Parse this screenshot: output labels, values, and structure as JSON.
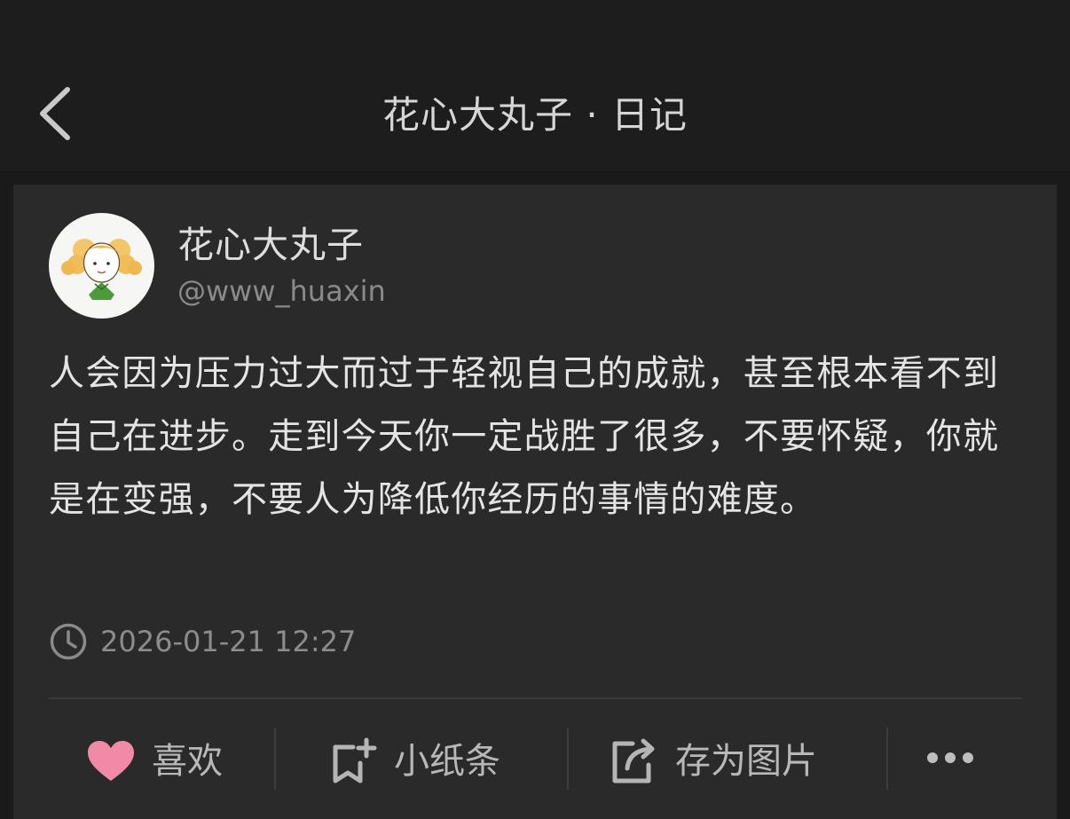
{
  "header": {
    "title": "花心大丸子 · 日记",
    "back_icon": "chevron-left-icon"
  },
  "post": {
    "author": {
      "name": "花心大丸子",
      "handle": "@www_huaxin",
      "avatar_icon": "cartoon-girl-avatar"
    },
    "content": "人会因为压力过大而过于轻视自己的成就，甚至根本看不到自己在进步。走到今天你一定战胜了很多，不要怀疑，你就是在变强，不要人为降低你经历的事情的难度。",
    "timestamp": "2026-01-21 12:27",
    "clock_icon": "clock-icon"
  },
  "actions": {
    "like_label": "喜欢",
    "like_color": "#f08aa6",
    "note_label": "小纸条",
    "save_image_label": "存为图片",
    "more_icon": "more-dots-icon"
  },
  "colors": {
    "background": "#1a1a1a",
    "header": "#1d1d1d",
    "card": "#2a2a2a"
  }
}
